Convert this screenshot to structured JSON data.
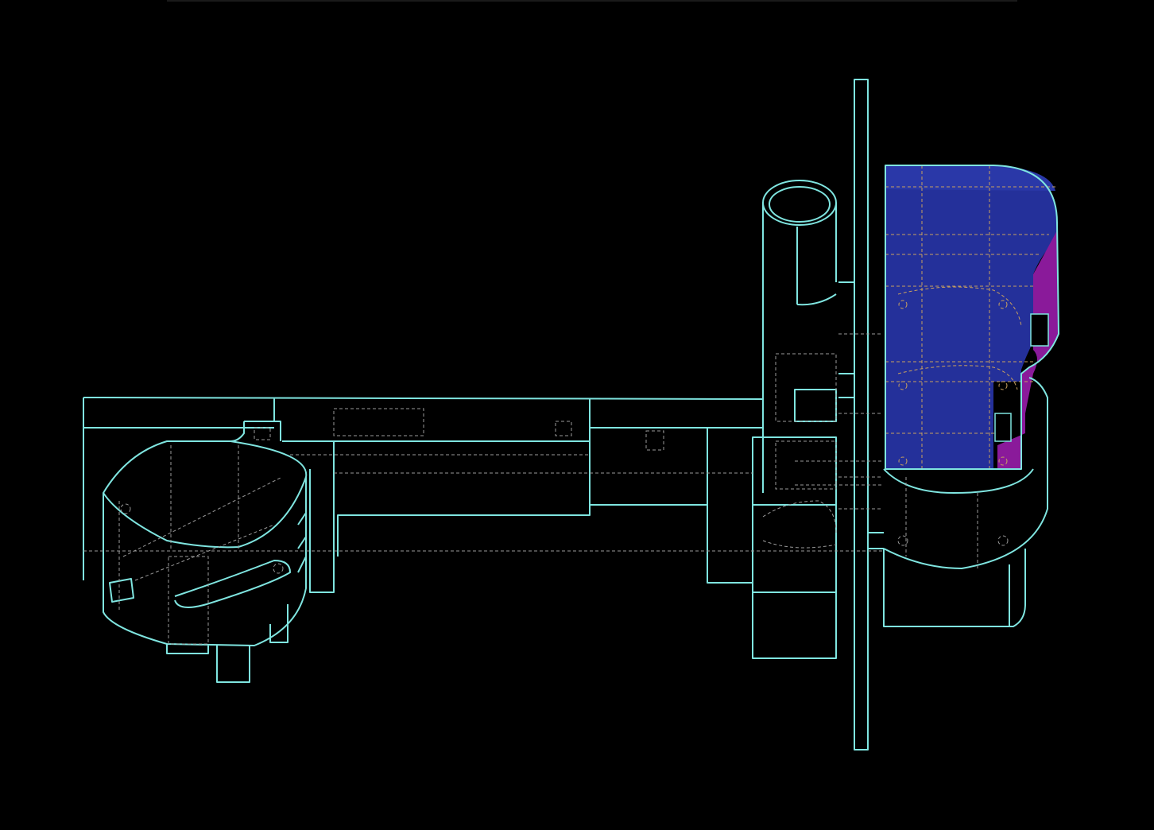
{
  "scene": {
    "background_color": "#000000",
    "wireframe_color": "#7fe5e0",
    "hidden_line_color": "#9a9a9a",
    "highlight_front_color": "#24309a",
    "highlight_top_color": "#2a38a8",
    "highlight_side_color": "#8a1a9a",
    "highlight_edge_color": "#c8a060"
  }
}
